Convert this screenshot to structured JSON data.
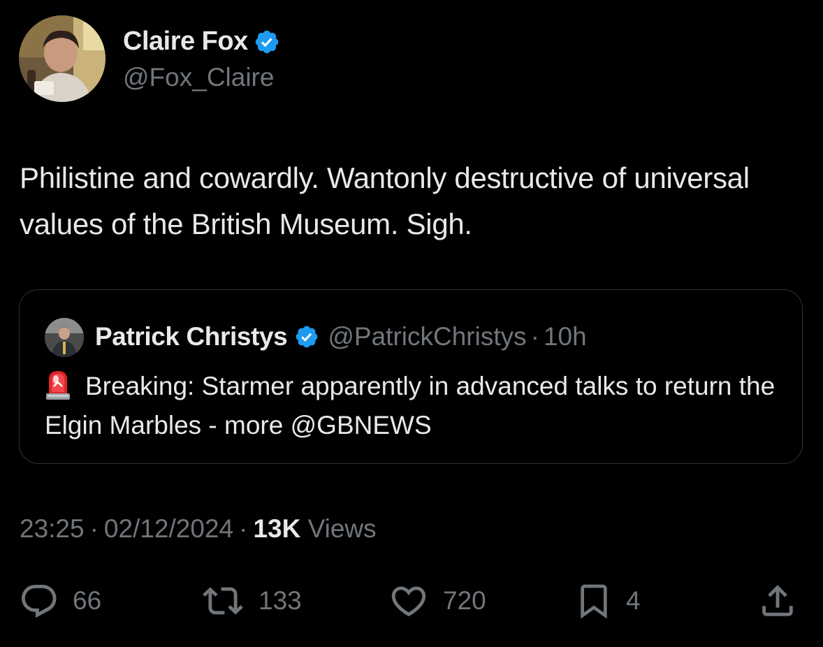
{
  "tweet": {
    "author": {
      "name": "Claire Fox",
      "handle": "@Fox_Claire",
      "verified": true
    },
    "text": "Philistine and cowardly. Wantonly destructive of universal values of the British Museum. Sigh.",
    "quoted": {
      "author_name": "Patrick Christys",
      "handle": "@PatrickChristys",
      "separator": "·",
      "time": "10h",
      "verified": true,
      "emoji": "siren-icon",
      "text": "Breaking: Starmer apparently in advanced talks to return the Elgin Marbles - more @GBNEWS"
    },
    "meta": {
      "time": "23:25",
      "date": "02/12/2024",
      "separator": "·",
      "views_count": "13K",
      "views_label": "Views"
    },
    "actions": {
      "replies": "66",
      "reposts": "133",
      "likes": "720",
      "bookmarks": "4"
    }
  },
  "colors": {
    "background": "#000000",
    "text_primary": "#e7e9ea",
    "text_secondary": "#71767b",
    "verified_blue": "#1d9bf0",
    "border": "#2f3336"
  }
}
